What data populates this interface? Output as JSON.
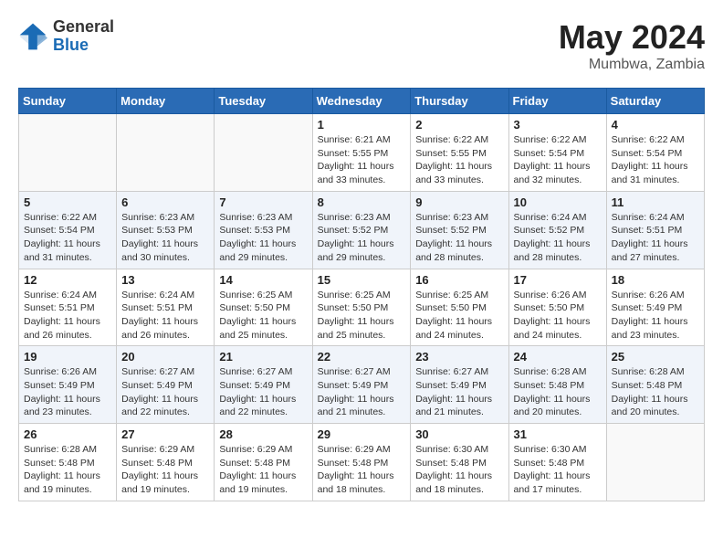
{
  "header": {
    "logo_general": "General",
    "logo_blue": "Blue",
    "title": "May 2024",
    "location": "Mumbwa, Zambia"
  },
  "days_of_week": [
    "Sunday",
    "Monday",
    "Tuesday",
    "Wednesday",
    "Thursday",
    "Friday",
    "Saturday"
  ],
  "weeks": [
    [
      {
        "day": "",
        "info": ""
      },
      {
        "day": "",
        "info": ""
      },
      {
        "day": "",
        "info": ""
      },
      {
        "day": "1",
        "info": "Sunrise: 6:21 AM\nSunset: 5:55 PM\nDaylight: 11 hours and 33 minutes."
      },
      {
        "day": "2",
        "info": "Sunrise: 6:22 AM\nSunset: 5:55 PM\nDaylight: 11 hours and 33 minutes."
      },
      {
        "day": "3",
        "info": "Sunrise: 6:22 AM\nSunset: 5:54 PM\nDaylight: 11 hours and 32 minutes."
      },
      {
        "day": "4",
        "info": "Sunrise: 6:22 AM\nSunset: 5:54 PM\nDaylight: 11 hours and 31 minutes."
      }
    ],
    [
      {
        "day": "5",
        "info": "Sunrise: 6:22 AM\nSunset: 5:54 PM\nDaylight: 11 hours and 31 minutes."
      },
      {
        "day": "6",
        "info": "Sunrise: 6:23 AM\nSunset: 5:53 PM\nDaylight: 11 hours and 30 minutes."
      },
      {
        "day": "7",
        "info": "Sunrise: 6:23 AM\nSunset: 5:53 PM\nDaylight: 11 hours and 29 minutes."
      },
      {
        "day": "8",
        "info": "Sunrise: 6:23 AM\nSunset: 5:52 PM\nDaylight: 11 hours and 29 minutes."
      },
      {
        "day": "9",
        "info": "Sunrise: 6:23 AM\nSunset: 5:52 PM\nDaylight: 11 hours and 28 minutes."
      },
      {
        "day": "10",
        "info": "Sunrise: 6:24 AM\nSunset: 5:52 PM\nDaylight: 11 hours and 28 minutes."
      },
      {
        "day": "11",
        "info": "Sunrise: 6:24 AM\nSunset: 5:51 PM\nDaylight: 11 hours and 27 minutes."
      }
    ],
    [
      {
        "day": "12",
        "info": "Sunrise: 6:24 AM\nSunset: 5:51 PM\nDaylight: 11 hours and 26 minutes."
      },
      {
        "day": "13",
        "info": "Sunrise: 6:24 AM\nSunset: 5:51 PM\nDaylight: 11 hours and 26 minutes."
      },
      {
        "day": "14",
        "info": "Sunrise: 6:25 AM\nSunset: 5:50 PM\nDaylight: 11 hours and 25 minutes."
      },
      {
        "day": "15",
        "info": "Sunrise: 6:25 AM\nSunset: 5:50 PM\nDaylight: 11 hours and 25 minutes."
      },
      {
        "day": "16",
        "info": "Sunrise: 6:25 AM\nSunset: 5:50 PM\nDaylight: 11 hours and 24 minutes."
      },
      {
        "day": "17",
        "info": "Sunrise: 6:26 AM\nSunset: 5:50 PM\nDaylight: 11 hours and 24 minutes."
      },
      {
        "day": "18",
        "info": "Sunrise: 6:26 AM\nSunset: 5:49 PM\nDaylight: 11 hours and 23 minutes."
      }
    ],
    [
      {
        "day": "19",
        "info": "Sunrise: 6:26 AM\nSunset: 5:49 PM\nDaylight: 11 hours and 23 minutes."
      },
      {
        "day": "20",
        "info": "Sunrise: 6:27 AM\nSunset: 5:49 PM\nDaylight: 11 hours and 22 minutes."
      },
      {
        "day": "21",
        "info": "Sunrise: 6:27 AM\nSunset: 5:49 PM\nDaylight: 11 hours and 22 minutes."
      },
      {
        "day": "22",
        "info": "Sunrise: 6:27 AM\nSunset: 5:49 PM\nDaylight: 11 hours and 21 minutes."
      },
      {
        "day": "23",
        "info": "Sunrise: 6:27 AM\nSunset: 5:49 PM\nDaylight: 11 hours and 21 minutes."
      },
      {
        "day": "24",
        "info": "Sunrise: 6:28 AM\nSunset: 5:48 PM\nDaylight: 11 hours and 20 minutes."
      },
      {
        "day": "25",
        "info": "Sunrise: 6:28 AM\nSunset: 5:48 PM\nDaylight: 11 hours and 20 minutes."
      }
    ],
    [
      {
        "day": "26",
        "info": "Sunrise: 6:28 AM\nSunset: 5:48 PM\nDaylight: 11 hours and 19 minutes."
      },
      {
        "day": "27",
        "info": "Sunrise: 6:29 AM\nSunset: 5:48 PM\nDaylight: 11 hours and 19 minutes."
      },
      {
        "day": "28",
        "info": "Sunrise: 6:29 AM\nSunset: 5:48 PM\nDaylight: 11 hours and 19 minutes."
      },
      {
        "day": "29",
        "info": "Sunrise: 6:29 AM\nSunset: 5:48 PM\nDaylight: 11 hours and 18 minutes."
      },
      {
        "day": "30",
        "info": "Sunrise: 6:30 AM\nSunset: 5:48 PM\nDaylight: 11 hours and 18 minutes."
      },
      {
        "day": "31",
        "info": "Sunrise: 6:30 AM\nSunset: 5:48 PM\nDaylight: 11 hours and 17 minutes."
      },
      {
        "day": "",
        "info": ""
      }
    ]
  ]
}
